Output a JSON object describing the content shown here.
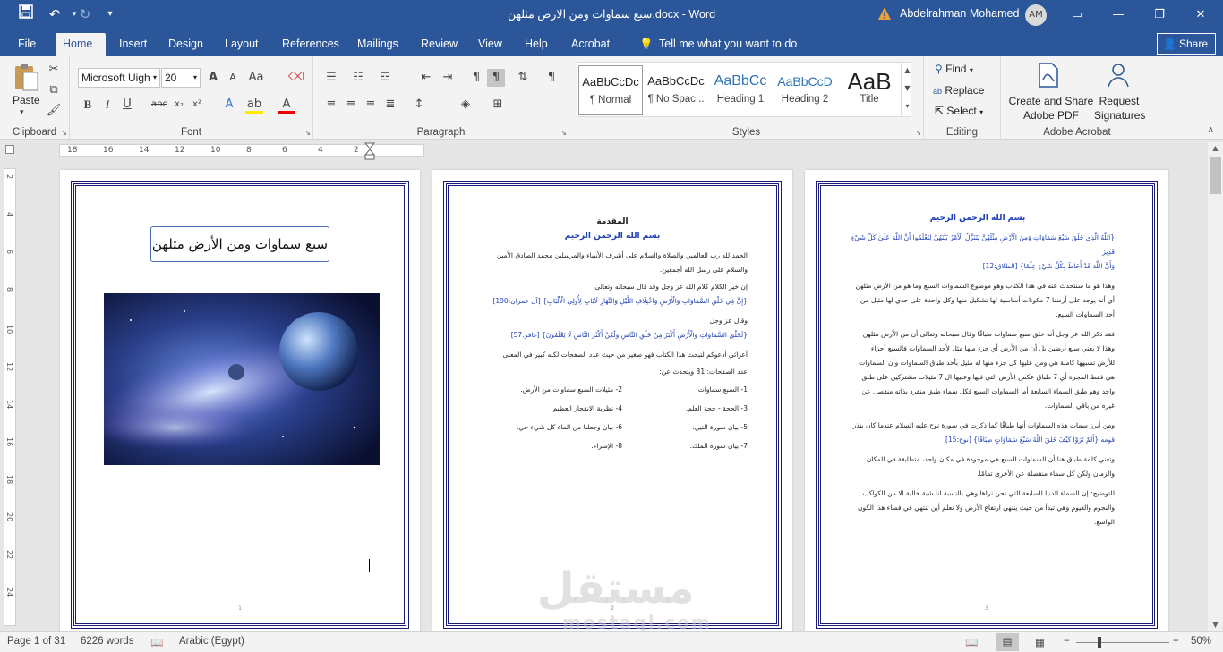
{
  "titlebar": {
    "title": "سبع سماوات ومن الارض مثلهن.docx  -  Word",
    "user": "Abdelrahman Mohamed",
    "avatar": "AM"
  },
  "qat": {
    "save": "save-icon",
    "undo": "undo-icon",
    "redo": "redo-icon"
  },
  "tabs": [
    "File",
    "Home",
    "Insert",
    "Design",
    "Layout",
    "References",
    "Mailings",
    "Review",
    "View",
    "Help",
    "Acrobat"
  ],
  "tellme": "Tell me what you want to do",
  "share": "Share",
  "clipboard": {
    "paste": "Paste",
    "label": "Clipboard"
  },
  "font": {
    "name": "Microsoft Uigh",
    "size": "20",
    "label": "Font"
  },
  "paragraph": {
    "label": "Paragraph"
  },
  "styles": {
    "label": "Styles",
    "items": [
      {
        "sample": "AaBbCcDc",
        "name": "¶ Normal"
      },
      {
        "sample": "AaBbCcDc",
        "name": "¶ No Spac..."
      },
      {
        "sample": "AaBbCc",
        "name": "Heading 1"
      },
      {
        "sample": "AaBbCcD",
        "name": "Heading 2"
      },
      {
        "sample": "AaB",
        "name": "Title"
      }
    ]
  },
  "editing": {
    "find": "Find",
    "replace": "Replace",
    "select": "Select",
    "label": "Editing"
  },
  "acrobat": {
    "create": "Create and Share Adobe PDF",
    "request": "Request Signatures",
    "label": "Adobe Acrobat"
  },
  "ruler": [
    "18",
    "16",
    "14",
    "12",
    "10",
    "8",
    "6",
    "4",
    "2"
  ],
  "vruler": [
    "2",
    "4",
    "6",
    "8",
    "10",
    "12",
    "14",
    "16",
    "18",
    "20",
    "22",
    "24"
  ],
  "page1": {
    "title": "سبع سماوات ومن الأرض مثلهن",
    "num": "1"
  },
  "page2": {
    "heading": "المقدمة",
    "basmala": "بسم الله الرحمن الرحيم",
    "p1": "الحمد لله رب العالمين والصلاة والسلام على أشرف الأنبياء والمرسلين محمد الصادق الأمين",
    "p1b": "والسلام على رسل الله أجمعين.",
    "p2": "إن خير الكلام كلام الله عز وجل وقد قال سبحانه وتعالى",
    "v1": "{إِنَّ فِي خَلْقِ السَّمَاوَاتِ وَالْأَرْضِ وَاخْتِلَافِ اللَّيْلِ وَالنَّهَارِ لَآيَاتٍ لِأُولِي الْأَلْبَابِ} [آل عمران:190]",
    "p3": "وقال عز وجل",
    "v2": "{لَخَلْقُ السَّمَاوَاتِ وَالْأَرْضِ أَكْبَرُ مِنْ خَلْقِ النَّاسِ وَلَٰكِنَّ أَكْثَرَ النَّاسِ لَا يَعْلَمُونَ} [غافر:57]",
    "p4": "أعزائي أدعوكم لتبحث هذا الكتاب فهو صغير من حيث عدد الصفحات لكنه كبير في المعنى",
    "p5": "عدد الصفحات: 31 ويتحدث عن:",
    "list": [
      {
        "r": "1- السبع سماوات.",
        "l": "2- مثيلات السبع سماوات من الأرض."
      },
      {
        "r": "3- الحجة - حجة العلم.",
        "l": "4- نظرية الانفجار العظيم."
      },
      {
        "r": "5- بيان سورة التين.",
        "l": "6- بيان وجعلنا من الماء كل شيء حي."
      },
      {
        "r": "7- بيان سورة الملك.",
        "l": "8- الإسراء."
      }
    ],
    "num": "2"
  },
  "page3": {
    "basmala": "بسم الله الرحمن الرحيم",
    "v1": "{اللَّهُ الَّذِي خَلَقَ سَبْعَ سَمَاوَاتٍ وَمِنَ الْأَرْضِ مِثْلَهُنَّ يَتَنَزَّلُ الْأَمْرُ بَيْنَهُنَّ لِتَعْلَمُوا أَنَّ اللَّهَ عَلَىٰ كُلِّ شَيْءٍ قَدِيرٌ",
    "v1b": "وَأَنَّ اللَّهَ قَدْ أَحَاطَ بِكُلِّ شَيْءٍ عِلْمًا} [الطلاق:12]",
    "p1": "وهذا هو ما سنتحدث عنه في هذا الكتاب وهو موضوع السماوات السبع وما هو من الأرض مثلهن",
    "p1b": "أي أنه يوجد على أرضنا 7 مكونات أساسية لها تشكيل منها وكل واحدة على حدي لها مثيل من",
    "p1c": "أحد السماوات السبع.",
    "p2": "فقد ذكر الله عز وجل أنه خلق سبع سماوات طباقًا وقال سبحانه وتعالى أن من الأرض مثلهن",
    "p2b": "وهذا لا يعني سبع أرضين بل أن من الأرض أي جزء منها مثل لأحد السماوات فالسبع أجزاء",
    "p2c": "للأرض تشبهها كاملة هي ومن عليها كل جزء منها له مثيل بأحد طباق السماوات وأن السماوات",
    "p2d": "هي فقط المجرة أي 7 طباق عكس الأرض التي فيها وعليها ال 7 مثيلات مشتركين على طبق",
    "p2e": "واحد وهو طبق السماء السابعة أما السماوات السبع فكل سماء طبق منفرد بذاته منفصل عن",
    "p2f": "غيره من باقي السماوات.",
    "p3": "ومن أبرز سمات هذه السماوات أنها طباقًا كما ذكرت في سورة نوح عليه السلام عندما كان ينذر",
    "p3b": "قومه {أَلَمْ تَرَوْا كَيْفَ خَلَقَ اللَّهُ سَبْعَ سَمَاوَاتٍ طِبَاقًا} [نوح:15]",
    "p4": "وتعني كلمة طباق هنا أن السماوات السبع هي موجودة في مكان واحد، متطابقة في المكان",
    "p4b": "والزمان ولكن كل سماء منفصلة عن الأخرى تمامًا.",
    "p5": "للتوضيح: إن السماء الدنيا السابعة التي نحن نراها وهي بالنسبة لنا شبة خالية الا من الكواكب",
    "p5b": "والنجوم والغيوم وهي تبدأ من حيث ينتهي ارتفاع الأرض ولا نعلم أين تنتهي في فضاء هذا الكون",
    "p5c": "الواسع.",
    "num": "3"
  },
  "watermark": {
    "ar": "مستقل",
    "en": "mostaql.com"
  },
  "status": {
    "page": "Page 1 of 31",
    "words": "6226 words",
    "lang": "Arabic (Egypt)",
    "zoom": "50%"
  }
}
